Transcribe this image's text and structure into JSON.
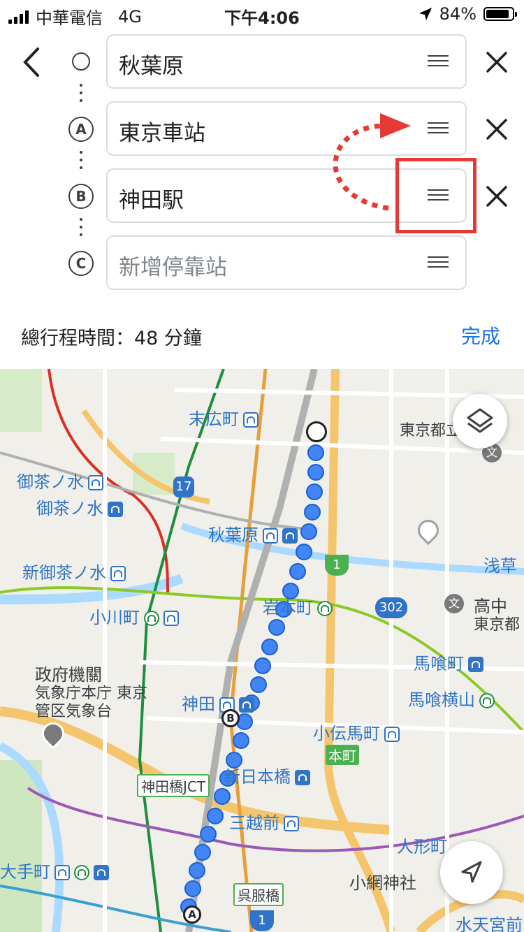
{
  "status_bar": {
    "carrier": "中華電信",
    "network": "4G",
    "time": "下午4:06",
    "battery": "84%"
  },
  "directions": {
    "origin": "秋葉原",
    "stops": [
      {
        "letter": "A",
        "value": "東京車站"
      },
      {
        "letter": "B",
        "value": "神田駅"
      },
      {
        "letter": "C",
        "placeholder": "新增停靠站"
      }
    ]
  },
  "footer": {
    "total_time": "總行程時間：48 分鐘",
    "done_label": "完成"
  },
  "map": {
    "labels": {
      "suehirocho": "末広町",
      "ochanomizu_metro": "御茶ノ水",
      "ochanomizu_jr": "御茶ノ水",
      "akihabara": "秋葉原",
      "shin_ochanomizu": "新御茶ノ水",
      "ogawamachi": "小川町",
      "iwamotocho": "岩本町",
      "govt_1": "政府機關",
      "govt_2": "気象庁本庁 東京",
      "govt_3": "管区気象台",
      "kanda": "神田",
      "kodenmacho": "小伝馬町",
      "honcho": "本町",
      "shin_nihombashi": "新日本橋",
      "kandabashi_jct": "神田橋JCT",
      "mitsukoshimae": "三越前",
      "otemachi": "大手町",
      "ningyocho": "人形町",
      "koami_jinja": "小網神社",
      "gofukubashi": "呉服橋",
      "tokyo_toritsu": "東京都立",
      "asakusa": "浅草",
      "koko": "高中",
      "tokyo_to": "東京都",
      "bakurocho": "馬喰町",
      "bakuro_yokoyama": "馬喰横山",
      "suitengumae": "水天宮前",
      "school_icon_char": "文"
    },
    "shields": {
      "route17": "17",
      "route1_top": "1",
      "route302": "302",
      "route1_bottom": "1"
    },
    "markers": {
      "a": "A",
      "b": "B"
    },
    "colors": {
      "route": "#4285f4",
      "highlight": "#e53935",
      "accent": "#1a73e8"
    }
  }
}
